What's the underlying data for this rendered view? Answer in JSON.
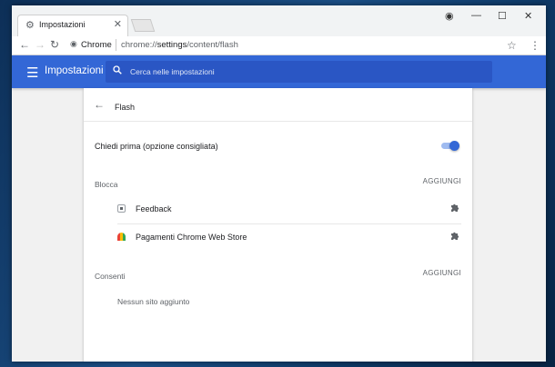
{
  "browser": {
    "tab_title": "Impostazioni",
    "url_chip": "Chrome",
    "url_prefix": "chrome://",
    "url_host": "settings",
    "url_path": "/content/flash"
  },
  "header": {
    "title": "Impostazioni",
    "search_placeholder": "Cerca nelle impostazioni"
  },
  "page": {
    "title": "Flash",
    "ask_first_label": "Chiedi prima (opzione consigliata)",
    "ask_first_enabled": true,
    "block": {
      "label": "Blocca",
      "add_label": "AGGIUNGI",
      "sites": [
        {
          "name": "Feedback",
          "icon": "feedback-favicon"
        },
        {
          "name": "Pagamenti Chrome Web Store",
          "icon": "webstore-favicon"
        }
      ]
    },
    "allow": {
      "label": "Consenti",
      "add_label": "AGGIUNGI",
      "empty_text": "Nessun sito aggiunto"
    }
  },
  "colors": {
    "header_blue": "#3367d6",
    "toggle_blue": "#3367d6"
  }
}
